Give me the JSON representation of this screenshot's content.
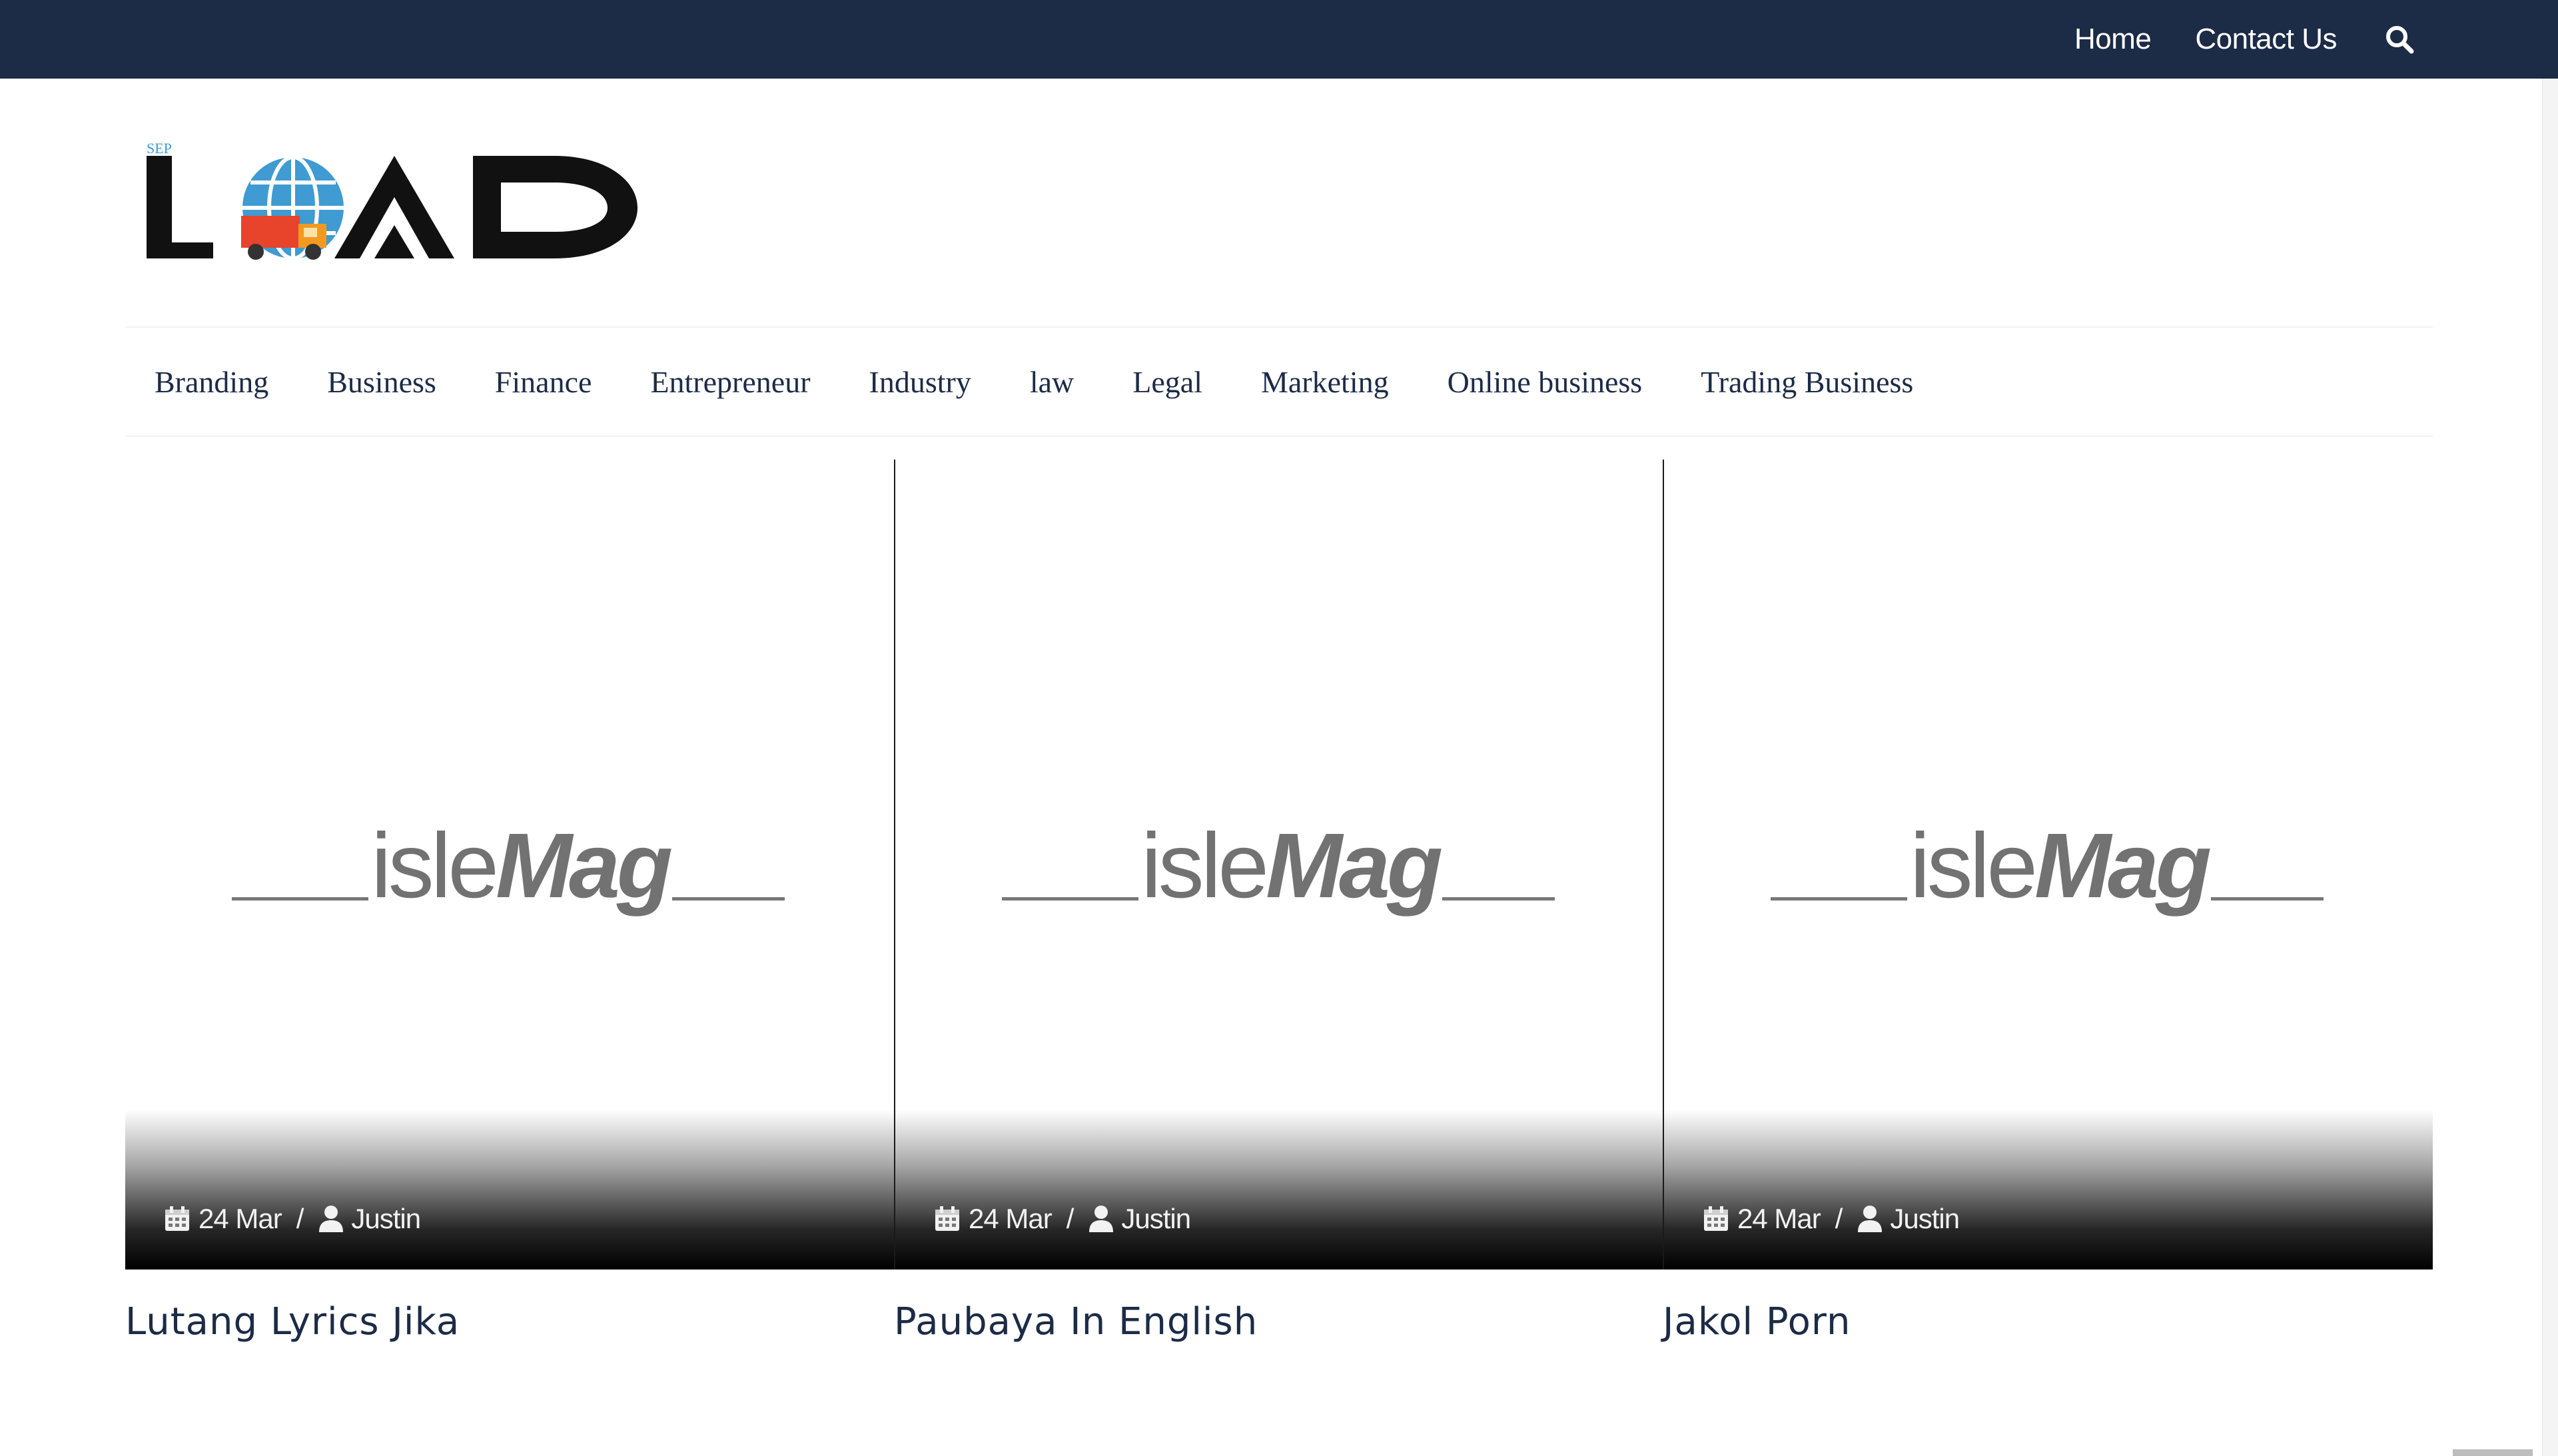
{
  "topnav": {
    "links": [
      "Home",
      "Contact Us"
    ],
    "search_icon": "search-icon"
  },
  "logo": {
    "text": "LOAD",
    "small_text": "SEP",
    "icons": [
      "globe-icon",
      "truck-icon"
    ],
    "colors": {
      "letters": "#111111",
      "globe": "#3f9bd1",
      "truck": "#e8442c"
    }
  },
  "categories": [
    "Branding",
    "Business",
    "Finance",
    "Entrepreneur",
    "Industry",
    "law",
    "Legal",
    "Marketing",
    "Online business",
    "Trading Business"
  ],
  "posts": [
    {
      "placeholder_main": "isle",
      "placeholder_em": "Mag",
      "date": "24 Mar",
      "separator": "/",
      "author": "Justin",
      "title": "Lutang Lyrics Jika"
    },
    {
      "placeholder_main": "isle",
      "placeholder_em": "Mag",
      "date": "24 Mar",
      "separator": "/",
      "author": "Justin",
      "title": "Paubaya In English"
    },
    {
      "placeholder_main": "isle",
      "placeholder_em": "Mag",
      "date": "24 Mar",
      "separator": "/",
      "author": "Justin",
      "title": "Jakol Porn"
    }
  ],
  "colors": {
    "topbar": "#1c2b46",
    "nav_text": "#1c2b46",
    "title_text": "#1c2b46",
    "placeholder_text": "#727272"
  }
}
